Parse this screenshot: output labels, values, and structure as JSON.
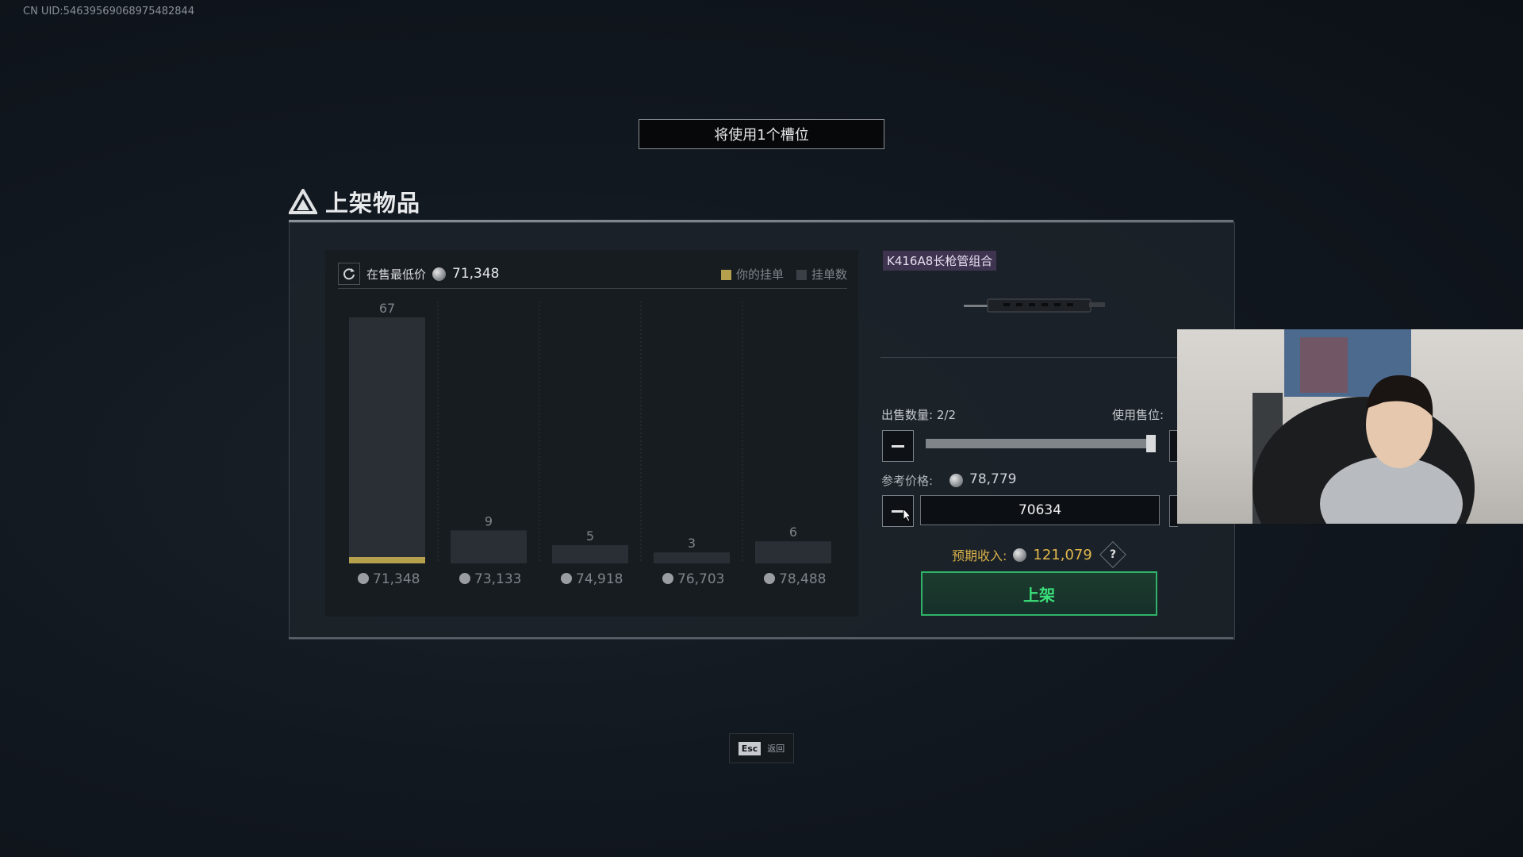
{
  "uid": "CN UID:5463956906897548284​4",
  "banner": "将使用1个槽位",
  "panel_title": "上架物品",
  "chart_header": {
    "lowest_label": "在售最低价",
    "lowest_value": "71,348",
    "legend_yours": "你的挂单",
    "legend_count": "挂单数"
  },
  "chart_data": {
    "type": "bar",
    "categories": [
      "71,348",
      "73,133",
      "74,918",
      "76,703",
      "78,488"
    ],
    "values": [
      67,
      9,
      5,
      3,
      6
    ],
    "highlight_index": 0,
    "colors": {
      "bar": "#2a2f35",
      "highlight": "#b5a04e"
    }
  },
  "item": {
    "name": "K416A8长枪管组合"
  },
  "quantity": {
    "label": "出售数量:",
    "value": "2/2",
    "fraction": 1.0
  },
  "use_slots": {
    "label": "使用售位:"
  },
  "reference": {
    "label": "参考价格:",
    "value": "78,779"
  },
  "price_input": {
    "value": "70634"
  },
  "income": {
    "label": "预期收入:",
    "value": "121,079",
    "help": "?"
  },
  "list_button": "上架",
  "esc": {
    "key": "Esc",
    "label": "返回"
  },
  "colors": {
    "accent_green": "#2fb36a",
    "gold": "#d8b24a",
    "item_tag": "#3e3450"
  }
}
